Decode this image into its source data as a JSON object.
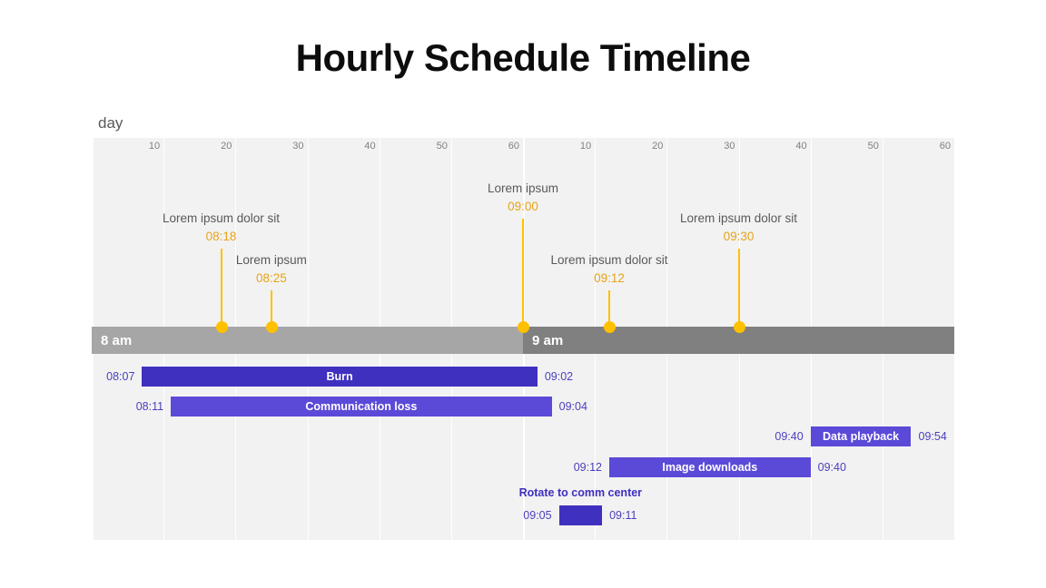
{
  "title": "Hourly Schedule Timeline",
  "group_label": "day",
  "colors": {
    "milestone": "#ffc000",
    "milestone_time_text": "#e8a317",
    "bar_dark": "#3f30bf",
    "bar_light": "#5b4ad8",
    "band_8am": "#a6a6a6",
    "band_9am": "#808080",
    "plot_bg": "#f2f2f2",
    "gridline": "#ffffff",
    "tick_text": "#808080",
    "title_text": "#0d0d0d"
  },
  "axis": {
    "tick_labels": [
      "10",
      "20",
      "30",
      "40",
      "50",
      "60",
      "10",
      "20",
      "30",
      "40",
      "50",
      "60"
    ],
    "segment_minutes": 10,
    "total_segments": 12
  },
  "hour_bands": [
    {
      "label": "8 am",
      "color": "#a6a6a6"
    },
    {
      "label": "9 am",
      "color": "#808080"
    }
  ],
  "milestones": [
    {
      "desc": "Lorem ipsum dolor sit",
      "time": "08:18"
    },
    {
      "desc": "Lorem ipsum",
      "time": "08:25"
    },
    {
      "desc": "Lorem ipsum",
      "time": "09:00"
    },
    {
      "desc": "Lorem ipsum dolor sit",
      "time": "09:12"
    },
    {
      "desc": "Lorem ipsum dolor sit",
      "time": "09:30"
    }
  ],
  "tasks": [
    {
      "label": "Burn",
      "start": "08:07",
      "end": "09:02",
      "color": "#3f30bf",
      "label_position": "inside"
    },
    {
      "label": "Communication loss",
      "start": "08:11",
      "end": "09:04",
      "color": "#5b4ad8",
      "label_position": "inside"
    },
    {
      "label": "Data playback",
      "start": "09:40",
      "end": "09:54",
      "color": "#5b4ad8",
      "label_position": "inside"
    },
    {
      "label": "Image downloads",
      "start": "09:12",
      "end": "09:40",
      "color": "#5b4ad8",
      "label_position": "inside"
    },
    {
      "label": "Rotate to comm center",
      "start": "09:05",
      "end": "09:11",
      "color": "#3f30bf",
      "label_position": "outside"
    }
  ],
  "chart_data": {
    "type": "timeline",
    "title": "Hourly Schedule Timeline",
    "group": "day",
    "xlabel": "",
    "ylabel": "",
    "x_axis": {
      "type": "time",
      "start": "08:00",
      "end": "09:60",
      "hour_segments": [
        "8 am",
        "9 am"
      ],
      "minor_tick_labels": [
        "10",
        "20",
        "30",
        "40",
        "50",
        "60",
        "10",
        "20",
        "30",
        "40",
        "50",
        "60"
      ],
      "minor_tick_minutes": 10,
      "gridlines": true
    },
    "milestones": [
      {
        "label": "Lorem ipsum dolor sit",
        "time": "08:18",
        "minutes_from_start": 18
      },
      {
        "label": "Lorem ipsum",
        "time": "08:25",
        "minutes_from_start": 25
      },
      {
        "label": "Lorem ipsum",
        "time": "09:00",
        "minutes_from_start": 60
      },
      {
        "label": "Lorem ipsum dolor sit",
        "time": "09:12",
        "minutes_from_start": 72
      },
      {
        "label": "Lorem ipsum dolor sit",
        "time": "09:30",
        "minutes_from_start": 90
      }
    ],
    "bars": [
      {
        "label": "Burn",
        "start": "08:07",
        "end": "09:02",
        "start_min": 7,
        "end_min": 62,
        "duration_min": 55,
        "row": 1
      },
      {
        "label": "Communication loss",
        "start": "08:11",
        "end": "09:04",
        "start_min": 11,
        "end_min": 64,
        "duration_min": 53,
        "row": 2
      },
      {
        "label": "Data playback",
        "start": "09:40",
        "end": "09:54",
        "start_min": 100,
        "end_min": 114,
        "duration_min": 14,
        "row": 3
      },
      {
        "label": "Image downloads",
        "start": "09:12",
        "end": "09:40",
        "start_min": 72,
        "end_min": 100,
        "duration_min": 28,
        "row": 4
      },
      {
        "label": "Rotate to comm center",
        "start": "09:05",
        "end": "09:11",
        "start_min": 65,
        "end_min": 71,
        "duration_min": 6,
        "row": 5
      }
    ],
    "legend": null
  }
}
